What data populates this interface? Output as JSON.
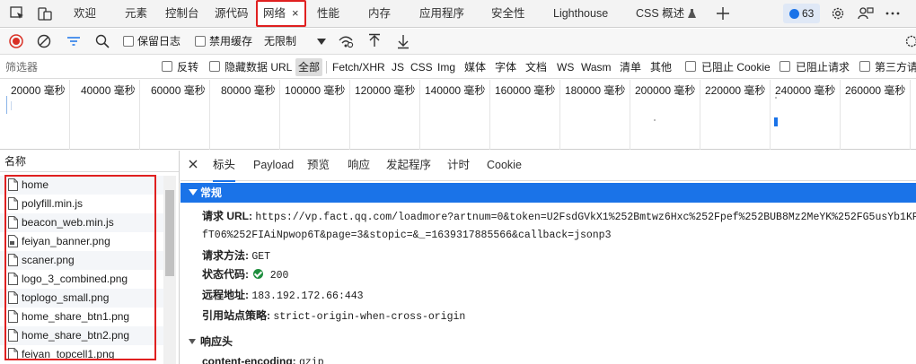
{
  "devtools_tabs": [
    {
      "label": "欢迎",
      "active": false
    },
    {
      "label": "元素",
      "active": false
    },
    {
      "label": "控制台",
      "active": false
    },
    {
      "label": "源代码",
      "active": false
    },
    {
      "label": "网络",
      "active": true,
      "close": "×"
    },
    {
      "label": "性能",
      "active": false
    },
    {
      "label": "内存",
      "active": false
    },
    {
      "label": "应用程序",
      "active": false
    },
    {
      "label": "安全性",
      "active": false
    },
    {
      "label": "Lighthouse",
      "active": false
    },
    {
      "label": "CSS 概述",
      "active": false,
      "icon": "flask-icon"
    }
  ],
  "issues_badge": {
    "count": "63"
  },
  "toolbar": {
    "preserve_log_label": "保留日志",
    "disable_cache_label": "禁用缓存",
    "throttle_value": "无限制"
  },
  "filter": {
    "placeholder": "筛选器",
    "invert_label": "反转",
    "hide_data_urls_label": "隐藏数据 URL",
    "types": [
      "全部",
      "Fetch/XHR",
      "JS",
      "CSS",
      "Img",
      "媒体",
      "字体",
      "文档",
      "WS",
      "Wasm",
      "清单",
      "其他"
    ],
    "active_type": "全部",
    "blocked_cookies_label": "已阻止 Cookie",
    "blocked_requests_label": "已阻止请求",
    "third_party_label": "第三方请"
  },
  "timeline": {
    "ticks": [
      "20000 毫秒",
      "40000 毫秒",
      "60000 毫秒",
      "80000 毫秒",
      "100000 毫秒",
      "120000 毫秒",
      "140000 毫秒",
      "160000 毫秒",
      "180000 毫秒",
      "200000 毫秒",
      "220000 毫秒",
      "240000 毫秒",
      "260000 毫秒"
    ]
  },
  "request_list": {
    "header": "名称",
    "items": [
      "home",
      "polyfill.min.js",
      "beacon_web.min.js",
      "feiyan_banner.png",
      "scaner.png",
      "logo_3_combined.png",
      "toplogo_small.png",
      "home_share_btn1.png",
      "home_share_btn2.png",
      "feiyan_topcell1.png"
    ]
  },
  "details": {
    "tabs": [
      "标头",
      "Payload",
      "预览",
      "响应",
      "发起程序",
      "计时",
      "Cookie"
    ],
    "active_tab": "标头",
    "general_title": "常规",
    "request_url_label": "请求 URL:",
    "request_url_line1": "https://vp.fact.qq.com/loadmore?artnum=0&token=U2FsdGVkX1%252Bmtwz6Hxc%252Fpef%252BUB8Mz2MeYK%252FG5usYb1KP5KZNx",
    "request_url_line2": "fT06%252FIAiNpwop6T&page=3&stopic=&_=1639317885566&callback=jsonp3",
    "method_label": "请求方法:",
    "method_value": "GET",
    "status_label": "状态代码:",
    "status_value": "200",
    "remote_label": "远程地址:",
    "remote_value": "183.192.172.66:443",
    "referrer_label": "引用站点策略:",
    "referrer_value": "strict-origin-when-cross-origin",
    "response_headers_title": "响应头",
    "content_encoding_label": "content-encoding:",
    "content_encoding_value": "gzip"
  }
}
